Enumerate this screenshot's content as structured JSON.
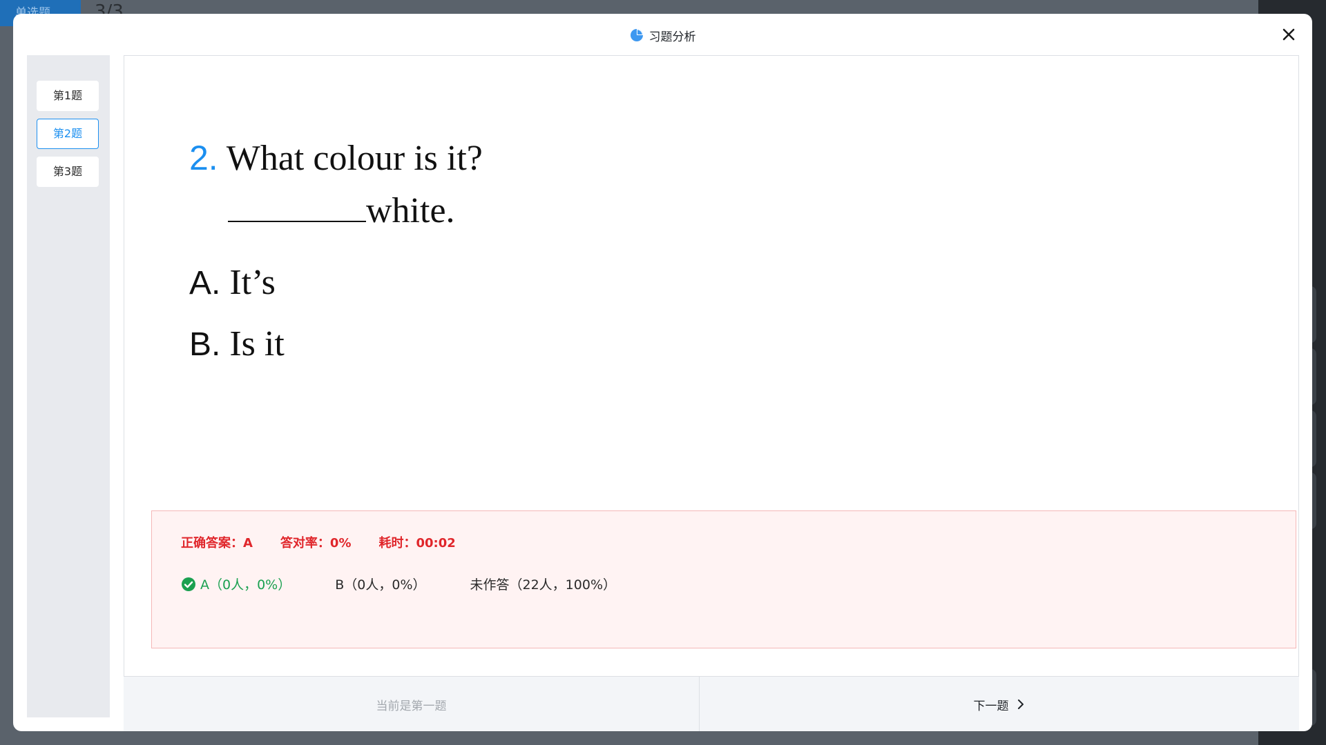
{
  "background": {
    "tab_label": "单选题",
    "progress": "3/3"
  },
  "modal": {
    "title": "习题分析",
    "close_icon": "close-icon",
    "title_icon": "pie-chart-icon"
  },
  "sidebar": {
    "items": [
      {
        "label": "第1题",
        "active": false
      },
      {
        "label": "第2题",
        "active": true
      },
      {
        "label": "第3题",
        "active": false
      }
    ]
  },
  "question": {
    "number": "2.",
    "text": "What colour is it?",
    "blank_suffix": "white.",
    "options": [
      {
        "letter": "A.",
        "text": "It’s"
      },
      {
        "letter": "B.",
        "text": "Is it"
      }
    ]
  },
  "stats": {
    "correct_answer": "正确答案：A",
    "accuracy": "答对率：0%",
    "time_spent": "耗时：00:02",
    "distribution": [
      {
        "label": "A（0人，0%）",
        "correct": true
      },
      {
        "label": "B（0人，0%）",
        "correct": false
      },
      {
        "label": "未作答（22人，100%）",
        "correct": false
      }
    ]
  },
  "footer": {
    "prev_label": "当前是第一题",
    "next_label": "下一题"
  },
  "colors": {
    "accent": "#1b8ff0",
    "error": "#e0262b",
    "success": "#1aa050"
  }
}
